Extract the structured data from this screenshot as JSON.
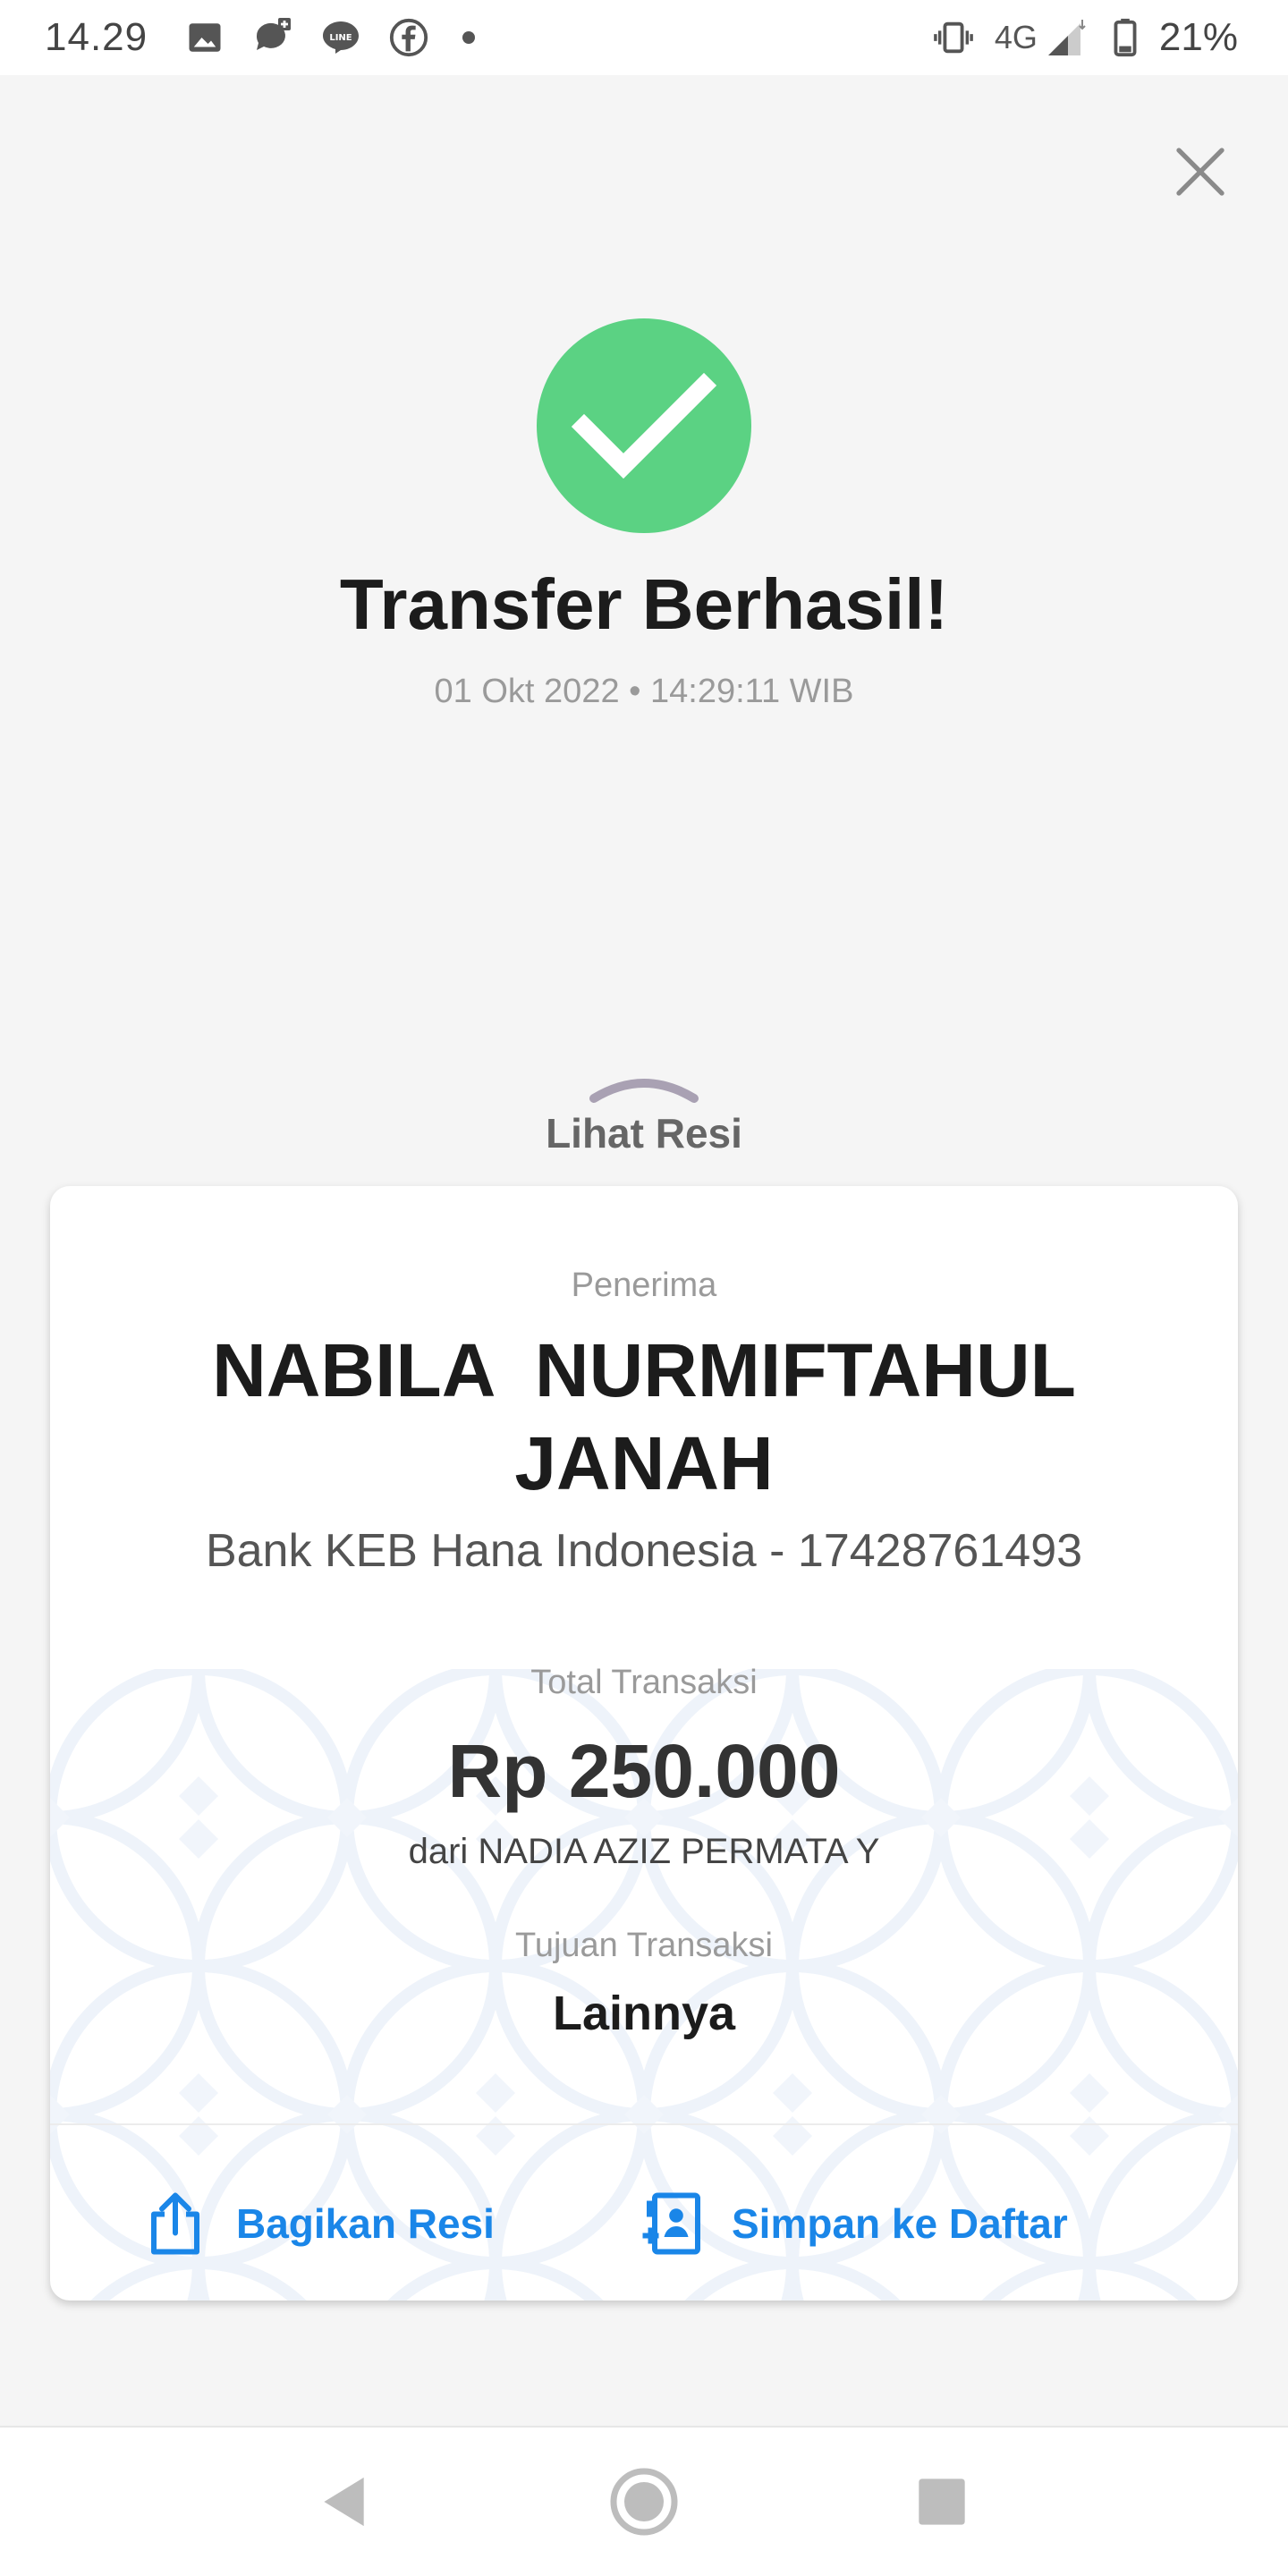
{
  "status_bar": {
    "time": "14.29",
    "icons_left": [
      "gallery-icon",
      "chat-plus-icon",
      "line-icon",
      "facebook-icon",
      "notification-dot-icon"
    ],
    "icons_right": [
      "vibrate-icon",
      "signal-icon",
      "battery-icon"
    ],
    "network": "4G",
    "battery": "21%"
  },
  "header": {
    "title": "Transfer Berhasil!",
    "datetime": "01 Okt 2022 • 14:29:11 WIB"
  },
  "receipt_toggle": {
    "label": "Lihat Resi"
  },
  "receipt": {
    "recipient_label": "Penerima",
    "recipient_name_line1": "NABILA  NURMIFTAHUL",
    "recipient_name_line2": "JANAH",
    "bank_account": "Bank KEB Hana Indonesia - 17428761493",
    "total_label": "Total Transaksi",
    "amount": "Rp 250.000",
    "from": "dari NADIA AZIZ PERMATA Y",
    "purpose_label": "Tujuan Transaksi",
    "purpose": "Lainnya"
  },
  "actions": {
    "share": "Bagikan Resi",
    "save": "Simpan ke Daftar"
  },
  "colors": {
    "success": "#5bd283",
    "accent": "#1a86e8",
    "background": "#f5f5f5"
  }
}
